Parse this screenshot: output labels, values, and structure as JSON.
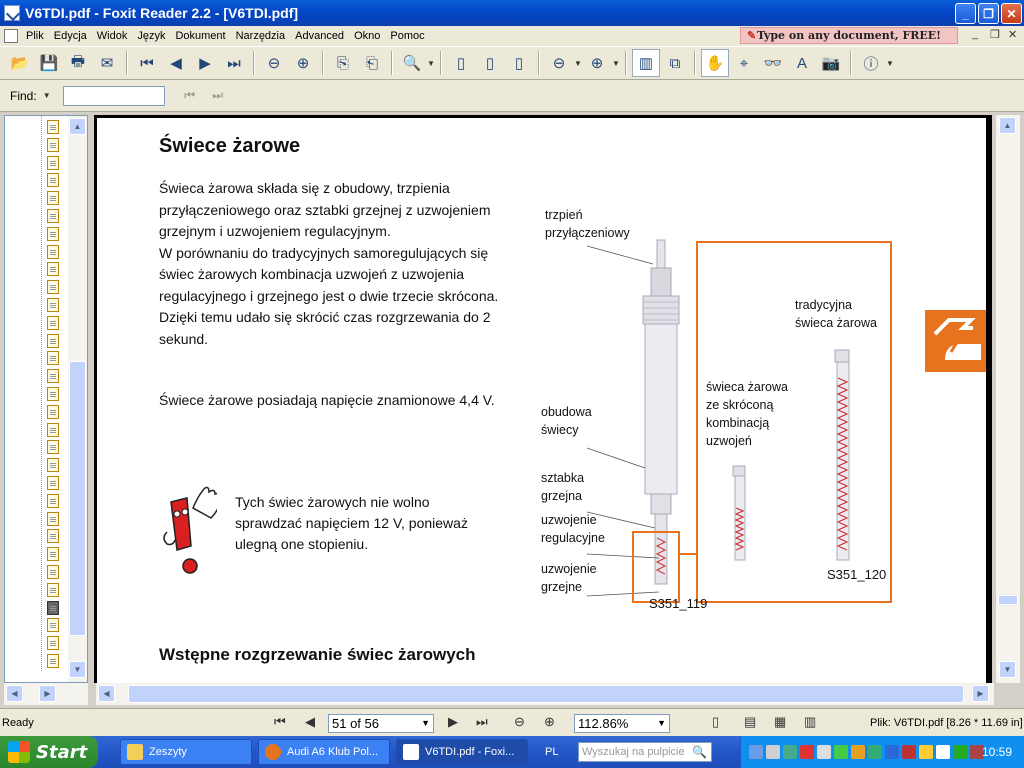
{
  "window": {
    "title": "V6TDI.pdf - Foxit Reader 2.2 - [V6TDI.pdf]"
  },
  "menu": [
    "Plik",
    "Edycja",
    "Widok",
    "Język",
    "Dokument",
    "Narzędzia",
    "Advanced",
    "Okno",
    "Pomoc"
  ],
  "ad_banner": "Type on any document, FREE!",
  "findbar": {
    "label": "Find:",
    "value": ""
  },
  "page": {
    "title": "Świece żarowe",
    "para1": "Świeca żarowa składa się z obudowy, trzpienia przyłączeniowego oraz sztabki grzejnej z uzwojeniem grzejnym i uzwojeniem regulacyjnym.\nW porównaniu do tradycyjnych samoregulujących się świec żarowych kombinacja uzwojeń z uzwojenia regulacyjnego i grzejnego jest o dwie trzecie skrócona. Dzięki temu udało się skrócić czas rozgrzewania do 2 sekund.",
    "para2": "Świece żarowe posiadają napięcie znamionowe 4,4 V.",
    "warning": "Tych świec żarowych nie wolno sprawdzać napięciem 12 V, ponieważ ulegną one stopieniu.",
    "section2": "Wstępne rozgrzewanie świec żarowych",
    "labels": {
      "trzpien": "trzpień\nprzyłączeniowy",
      "obudowa": "obudowa\nświecy",
      "sztabka": "sztabka\ngrzejna",
      "uzw_reg": "uzwojenie\nregulacyjne",
      "uzw_grz": "uzwojenie\ngrzejne",
      "tradycyjna": "tradycyjna\nświeca żarowa",
      "skrocona": "świeca żarowa\nze skróconą\nkombinacją\nuzwojeń"
    },
    "fig1": "S351_119",
    "fig2": "S351_120"
  },
  "status": {
    "ready": "Ready",
    "page": "51 of 56",
    "zoom": "112.86%",
    "fileinfo": "Plik: V6TDI.pdf [8.26 * 11.69 in]"
  },
  "taskbar": {
    "start": "Start",
    "tasks": [
      "Zeszyty",
      "Audi A6 Klub Pol...",
      "V6TDI.pdf - Foxi..."
    ],
    "lang": "PL",
    "search_placeholder": "Wyszukaj na pulpicie",
    "clock": "10:59"
  },
  "colors": {
    "accent_orange": "#e8731f",
    "title_blue": "#0348c8",
    "warning_red": "#d82020"
  }
}
